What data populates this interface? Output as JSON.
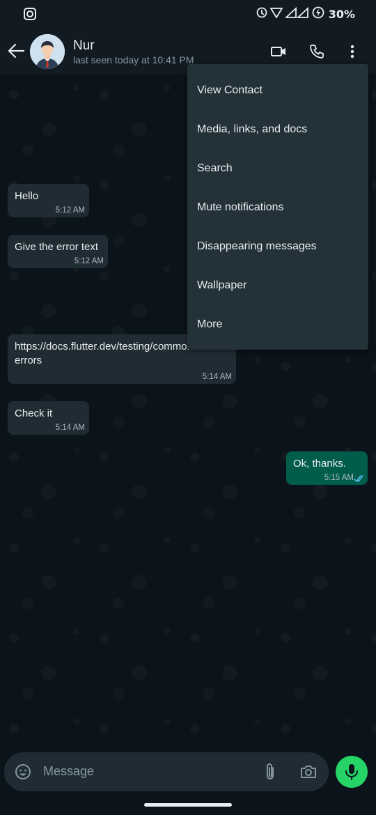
{
  "status_bar": {
    "battery_text": "30%"
  },
  "header": {
    "contact_name": "Nur",
    "last_seen": "last seen today at 10:41 PM"
  },
  "messages": [
    {
      "text": "Hello",
      "time": "5:12 AM",
      "direction": "incoming"
    },
    {
      "text": "Give the error text",
      "time": "5:12 AM",
      "direction": "incoming"
    },
    {
      "text": "https://docs.flutter.dev/testing/common-\nerrors",
      "time": "5:14 AM",
      "direction": "incoming"
    },
    {
      "text": "Check it",
      "time": "5:14 AM",
      "direction": "incoming"
    },
    {
      "text": "Ok, thanks.",
      "time": "5:15 AM",
      "direction": "outgoing",
      "read": true
    }
  ],
  "menu": {
    "items": [
      "View Contact",
      "Media, links, and docs",
      "Search",
      "Mute notifications",
      "Disappearing messages",
      "Wallpaper",
      "More"
    ]
  },
  "input": {
    "placeholder": "Message"
  },
  "colors": {
    "background": "#0b141a",
    "header": "#111b21",
    "incoming_bubble": "#202c33",
    "outgoing_bubble": "#005c4b",
    "menu": "#233138",
    "mic_button": "#25d366",
    "read_ticks": "#53bdeb"
  }
}
